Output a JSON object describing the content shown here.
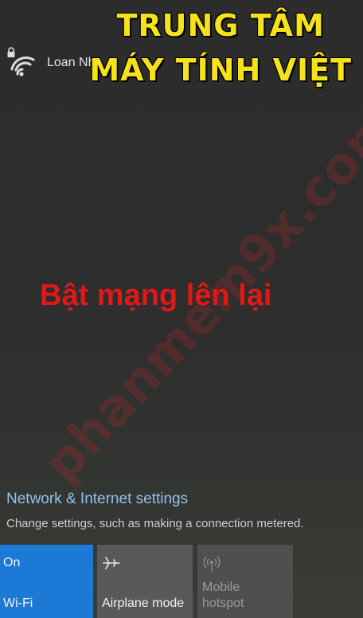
{
  "overlay": {
    "title_line1": "TRUNG TÂM",
    "title_line2": "MÁY TÍNH VIỆT",
    "caption": "Bật mạng lên lại",
    "watermark": "phanmem9x.com"
  },
  "network": {
    "name": "Loan Nhu",
    "icon": "wifi-secured-icon"
  },
  "settings": {
    "link_label": "Network & Internet settings",
    "description": "Change settings, such as making a connection metered."
  },
  "quick_actions": {
    "wifi": {
      "state": "On",
      "label": "Wi-Fi",
      "icon": "wifi-icon"
    },
    "airplane": {
      "label": "Airplane mode",
      "icon": "airplane-icon"
    },
    "hotspot": {
      "label_line1": "Mobile",
      "label_line2": "hotspot",
      "icon": "hotspot-icon"
    }
  },
  "colors": {
    "accent": "#1c7ad6",
    "link": "#8fc4f0",
    "overlay_yellow": "#f5e21b",
    "caption_red": "#e01818"
  }
}
